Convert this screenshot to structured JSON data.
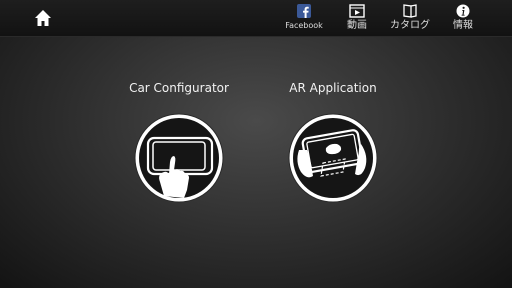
{
  "header": {
    "nav": [
      {
        "label": "Facebook",
        "icon": "facebook-icon"
      },
      {
        "label": "動画",
        "icon": "video-icon"
      },
      {
        "label": "カタログ",
        "icon": "catalog-book-icon"
      },
      {
        "label": "情報",
        "icon": "info-icon"
      }
    ]
  },
  "main": {
    "options": [
      {
        "title": "Car Configurator",
        "icon": "tablet-touch-icon"
      },
      {
        "title": "AR Application",
        "icon": "ar-tablet-icon"
      }
    ]
  },
  "colors": {
    "facebook": "#3b5998",
    "background": "#2c2c2c",
    "topbar": "#151515"
  }
}
